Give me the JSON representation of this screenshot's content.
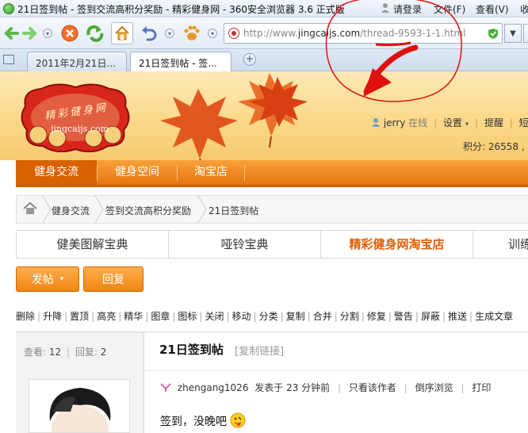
{
  "window": {
    "title": "21日签到帖 - 签到交流高积分奖励 - 精彩健身网 - 360安全浏览器 3.6 正式版",
    "login": "请登录",
    "menu": [
      "文件(F)",
      "查看(V)",
      "收"
    ]
  },
  "address": {
    "url_prefix": "http://www.",
    "url_domain": "jingcaijs.com",
    "url_path": "/thread-9593-1-1.html"
  },
  "tabs": [
    {
      "label": "2011年2月21日..."
    },
    {
      "label": "21日签到帖 - 签..."
    }
  ],
  "header": {
    "logo_text": "精彩健身网",
    "logo_url": "jingcaijs.com",
    "username": "jerry",
    "status": "在线",
    "links": [
      "设置",
      "提醒",
      "短消"
    ],
    "points": "积分: 26558 ,"
  },
  "main_nav": [
    "健身交流",
    "健身空间",
    "淘宝店"
  ],
  "breadcrumb": [
    "健身交流",
    "签到交流高积分奖励",
    "21日签到帖"
  ],
  "quick_tabs": [
    "健美图解宝典",
    "哑铃宝典",
    "精彩健身网淘宝店",
    "训练"
  ],
  "buttons": {
    "post": "发帖",
    "reply": "回复"
  },
  "mod_tools": [
    "删除",
    "升降",
    "置顶",
    "高亮",
    "精华",
    "图章",
    "图标",
    "关闭",
    "移动",
    "分类",
    "复制",
    "合并",
    "分割",
    "修复",
    "警告",
    "屏蔽",
    "推送",
    "生成文章"
  ],
  "thread": {
    "views_label": "查看:",
    "views": "12",
    "replies_label": "回复:",
    "replies": "2",
    "title": "21日签到帖",
    "copy_link": "[复制链接]",
    "author": "zhengang1026",
    "posted": "发表于 23 分钟前",
    "only_author": "只看该作者",
    "reverse": "倒序浏览",
    "print": "打印",
    "content": "签到，没晚吧"
  },
  "colors": {
    "nav_orange": "#e8750f",
    "highlight": "#e35f00",
    "annotation_red": "#e01010"
  }
}
